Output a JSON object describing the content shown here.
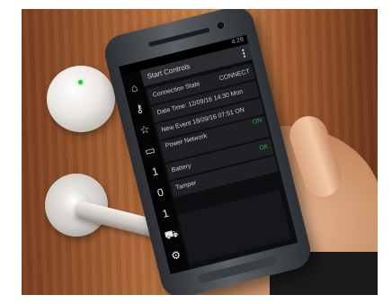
{
  "phone_screen": {
    "status_time": "4:28",
    "app_title": "Start Controls",
    "rows": [
      {
        "label": "Connection State",
        "value": "CONNECT"
      },
      {
        "label": "Date Time: 12/09/16 14:30 Mon",
        "value": ""
      },
      {
        "label": "New Event 18/09/16 07:51 ON",
        "value": ""
      },
      {
        "label": "Power Network",
        "value": "ON"
      },
      {
        "label": "Battery",
        "value": "OK"
      },
      {
        "label": "Tamper",
        "value": ""
      }
    ],
    "sidebar_icons": [
      "home-icon",
      "key-icon",
      "star-icon",
      "card-icon",
      "number-1-icon",
      "number-0-icon",
      "number-1-icon",
      "car-icon",
      "settings-icon"
    ]
  },
  "colors": {
    "status_ok": "#2ea64b",
    "reader_led": "#25c23a",
    "door_wood": "#b06a3a"
  }
}
